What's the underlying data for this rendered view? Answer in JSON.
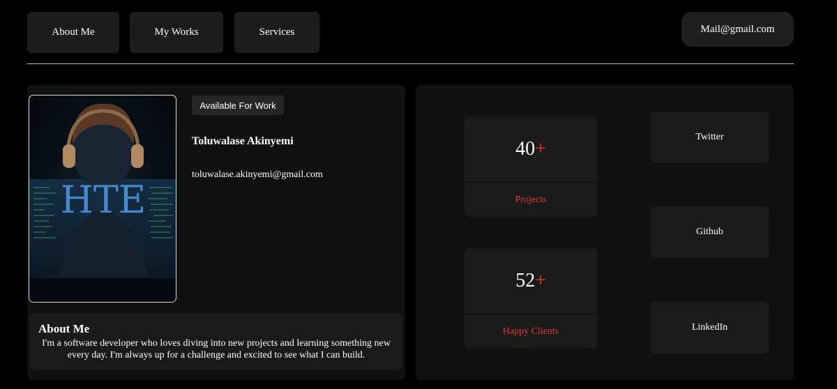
{
  "nav": {
    "about_label": "About Me",
    "works_label": "My Works",
    "services_label": "Services"
  },
  "contact": {
    "mail_label": "Mail@gmail.com"
  },
  "profile": {
    "badge": "Available For Work",
    "name": "Toluwalase Akinyemi",
    "email": "toluwalase.akinyemi@gmail.com",
    "photo_monogram": "HTE",
    "about_title": "About Me",
    "about_text": "I'm a software developer who loves diving into new projects and learning something new every day. I'm always up for a challenge and excited to see what I can build."
  },
  "stats": {
    "projects_value": "40",
    "projects_suffix": "+",
    "projects_label": "Projects",
    "clients_value": "52",
    "clients_suffix": "+",
    "clients_label": "Happy Clients"
  },
  "social": {
    "twitter_label": "Twitter",
    "github_label": "Github",
    "linkedin_label": "LinkedIn"
  },
  "colors": {
    "background": "#000000",
    "panel": "#111111",
    "card": "#1b1b1b",
    "accent": "#e03a2b",
    "text": "#ffffff"
  }
}
